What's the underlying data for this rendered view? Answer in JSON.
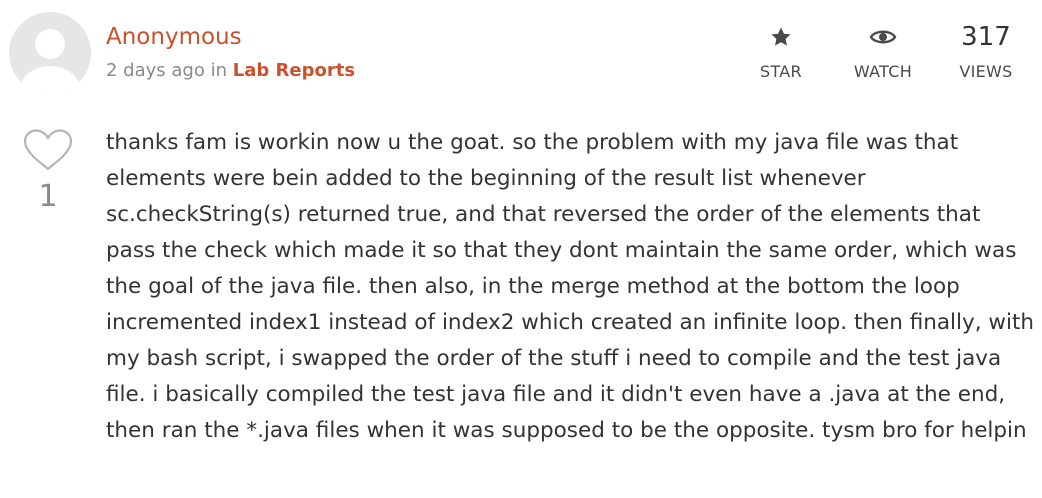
{
  "author": {
    "name": "Anonymous",
    "avatar_icon": "default-avatar-icon"
  },
  "meta": {
    "time": "2 days ago",
    "in_label": "in",
    "category": "Lab Reports"
  },
  "stats": {
    "star": {
      "icon": "star-icon",
      "label": "STAR"
    },
    "watch": {
      "icon": "eye-icon",
      "label": "WATCH"
    },
    "views": {
      "count": "317",
      "label": "VIEWS"
    }
  },
  "vote": {
    "icon": "heart-icon",
    "count": "1"
  },
  "body": {
    "text": "thanks fam is workin now u the goat. so the problem with my java file was that elements were bein added to the beginning of the result list whenever sc.checkString(s) returned true, and that reversed the order of the elements that pass the check which made it so that they dont maintain the same order, which was the goal of the java file. then also, in the merge method at the bottom the loop incremented index1 instead of index2 which created an infinite loop. then finally, with my bash script, i swapped the order of the stuff i need to compile and the test java file. i basically compiled the test java file and it didn't even have a .java at the end, then ran the *.java files when it was supposed to be the opposite. tysm bro for helpin"
  },
  "colors": {
    "accent": "#c9512e",
    "muted": "#8a8a8a",
    "text": "#333333",
    "avatar_bg": "#e6e6e6",
    "avatar_fg": "#ffffff"
  }
}
